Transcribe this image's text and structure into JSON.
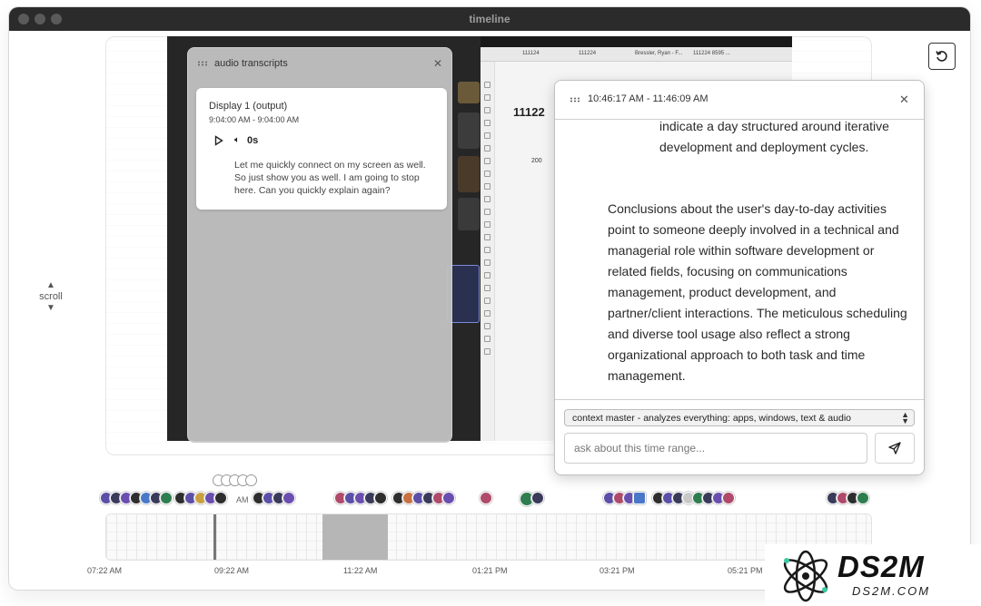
{
  "window": {
    "title": "timeline"
  },
  "scroll": {
    "label": "scroll"
  },
  "screenshot_frame": {
    "tabs": [
      "111124",
      "111224",
      "Bressler, Ryan - F...",
      "111224 8595 ..."
    ],
    "big_text": "11122",
    "small_text": "200"
  },
  "audio_panel": {
    "title": "audio transcripts",
    "entry": {
      "display": "Display 1 (output)",
      "time": "9:04:00 AM - 9:04:00 AM",
      "duration": "0s",
      "text": "Let me quickly connect on my screen as well. So just show you as well. I am going to stop here. Can you quickly explain again?"
    }
  },
  "chat_panel": {
    "range": "10:46:17 AM - 11:46:09 AM",
    "bullet_tail": "indicate a day structured around iterative development and deployment cycles.",
    "paragraph": "Conclusions about the user's day-to-day activities point to someone deeply involved in a technical and managerial role within software development or related fields, focusing on communications management, product development, and partner/client interactions. The meticulous scheduling and diverse tool usage also reflect a strong organizational approach to both task and time management.",
    "model": "context master - analyzes everything: apps, windows, text & audio",
    "input_placeholder": "ask about this time range..."
  },
  "timeline": {
    "partial_tick": "AM",
    "ticks": [
      "07:22 AM",
      "09:22 AM",
      "11:22 AM",
      "01:21 PM",
      "03:21 PM",
      "05:21 PM"
    ],
    "accent_colors": [
      "#5b4fa8",
      "#3a3a5a",
      "#2e7d4f",
      "#6a4fb0",
      "#4a78c8",
      "#b04a6a"
    ]
  },
  "watermark": {
    "main": "DS2M",
    "sub": "DS2M.COM"
  }
}
